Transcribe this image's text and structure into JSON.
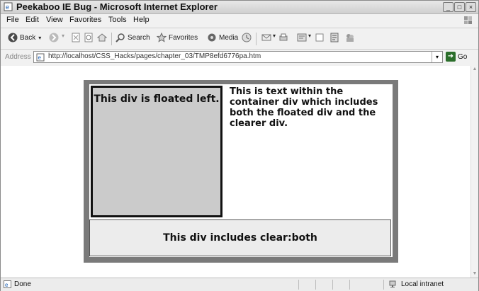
{
  "window": {
    "title": "Peekaboo IE Bug - Microsoft Internet Explorer"
  },
  "menu": [
    "File",
    "Edit",
    "View",
    "Favorites",
    "Tools",
    "Help"
  ],
  "toolbar": {
    "back": "Back",
    "search": "Search",
    "favorites": "Favorites",
    "media": "Media"
  },
  "address": {
    "label": "Address",
    "url": "http://localhost/CSS_Hacks/pages/chapter_03/TMP8efd6776pa.htm",
    "go": "Go"
  },
  "page": {
    "floated_text": "This div is floated left.",
    "container_text": "This is text within the container div which includes both the floated div and the clearer div.",
    "clearer_text": "This div includes clear:both"
  },
  "status": {
    "left": "Done",
    "zone": "Local intranet"
  }
}
